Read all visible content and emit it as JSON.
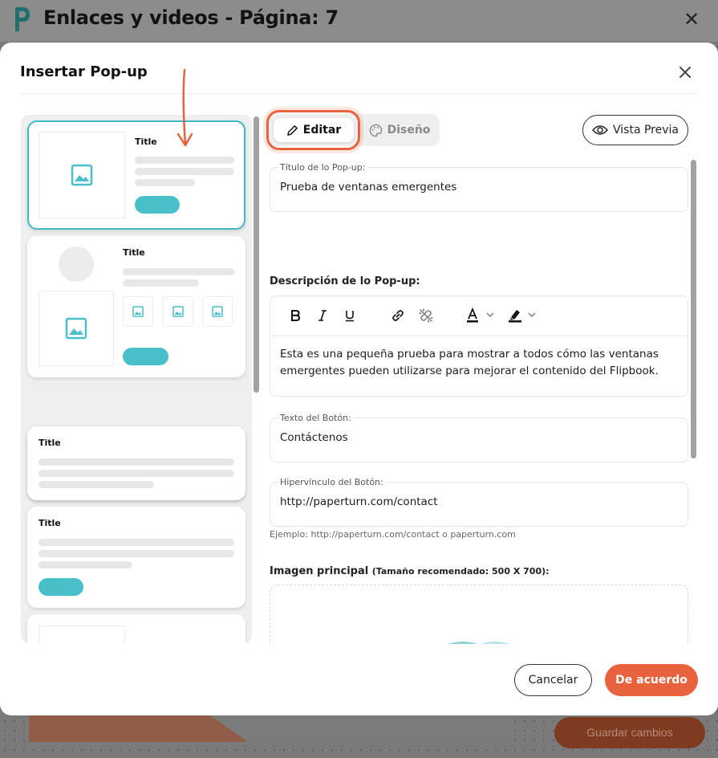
{
  "background": {
    "title": "Enlaces y videos - Página: 7",
    "save_label": "Guardar cambios"
  },
  "modal": {
    "title": "Insertar Pop-up"
  },
  "templates": {
    "title_text": "Title"
  },
  "tabs": {
    "edit_label": "Editar",
    "design_label": "Diseño"
  },
  "preview_label": "Vista Previa",
  "form": {
    "popup_title": {
      "label": "Título de lo Pop-up:",
      "value": "Prueba de ventanas emergentes"
    },
    "description": {
      "label": "Descripción de lo Pop-up:",
      "value": "Esta es una pequeña prueba para mostrar a todos cómo las ventanas emergentes pueden utilizarse para mejorar el contenido del Flipbook."
    },
    "button_text": {
      "label": "Texto del Botón:",
      "value": "Contáctenos"
    },
    "button_link": {
      "label": "Hipervínculo del Botón:",
      "value": "http://paperturn.com/contact",
      "example": "Ejemplo: http://paperturn.com/contact o paperturn.com"
    },
    "main_image": {
      "label": "Imagen principal",
      "hint": "(Tamaño recomendado: 500 X 700):"
    }
  },
  "footer": {
    "cancel_label": "Cancelar",
    "ok_label": "De acuerdo"
  },
  "colors": {
    "accent": "#e9623e",
    "teal": "#48bfc9"
  }
}
